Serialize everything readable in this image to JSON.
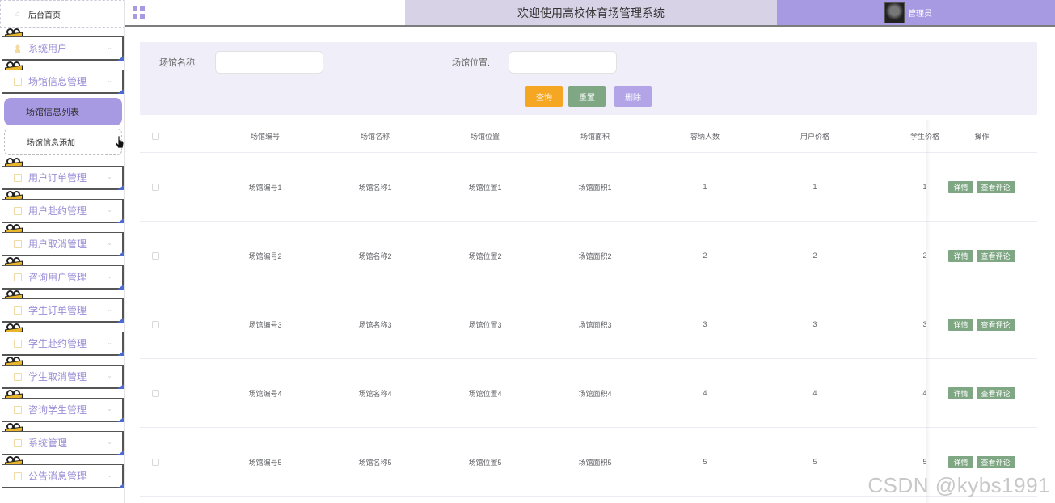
{
  "sidebar": {
    "home": "后台首页",
    "menus": [
      {
        "label": "系统用户",
        "icon": "user-icon"
      },
      {
        "label": "场馆信息管理",
        "icon": "folder-icon"
      },
      {
        "label": "用户订单管理",
        "icon": "folder-icon"
      },
      {
        "label": "用户赴约管理",
        "icon": "folder-icon"
      },
      {
        "label": "用户取消管理",
        "icon": "folder-icon"
      },
      {
        "label": "咨询用户管理",
        "icon": "folder-icon"
      },
      {
        "label": "学生订单管理",
        "icon": "folder-icon"
      },
      {
        "label": "学生赴约管理",
        "icon": "folder-icon"
      },
      {
        "label": "学生取消管理",
        "icon": "folder-icon"
      },
      {
        "label": "咨询学生管理",
        "icon": "folder-icon"
      },
      {
        "label": "系统管理",
        "icon": "settings-icon"
      },
      {
        "label": "公告消息管理",
        "icon": "info-icon"
      }
    ],
    "submenu": {
      "active": "场馆信息列表",
      "other": "场馆信息添加"
    }
  },
  "header": {
    "title": "欢迎使用高校体育场管理系统",
    "user": "管理员"
  },
  "search": {
    "name_label": "场馆名称:",
    "location_label": "场馆位置:",
    "name_value": "",
    "location_value": "",
    "query_label": "查询",
    "reset_label": "重置",
    "delete_label": "删除"
  },
  "table": {
    "headers": [
      "场馆编号",
      "场馆名称",
      "场馆位置",
      "场馆面积",
      "容纳人数",
      "用户价格",
      "学生价格",
      "操作"
    ],
    "rows": [
      [
        "场馆编号1",
        "场馆名称1",
        "场馆位置1",
        "场馆面积1",
        "1",
        "1",
        "1"
      ],
      [
        "场馆编号2",
        "场馆名称2",
        "场馆位置2",
        "场馆面积2",
        "2",
        "2",
        "2"
      ],
      [
        "场馆编号3",
        "场馆名称3",
        "场馆位置3",
        "场馆面积3",
        "3",
        "3",
        "3"
      ],
      [
        "场馆编号4",
        "场馆名称4",
        "场馆位置4",
        "场馆面积4",
        "4",
        "4",
        "4"
      ],
      [
        "场馆编号5",
        "场馆名称5",
        "场馆位置5",
        "场馆面积5",
        "5",
        "5",
        "5"
      ]
    ],
    "detail_label": "详情",
    "comment_label": "查看评论"
  },
  "watermark": "CSDN @kybs1991",
  "colors": {
    "accent": "#a79ae2",
    "query": "#f5a623",
    "reset": "#7fa784",
    "delete": "#b2a4e6"
  }
}
